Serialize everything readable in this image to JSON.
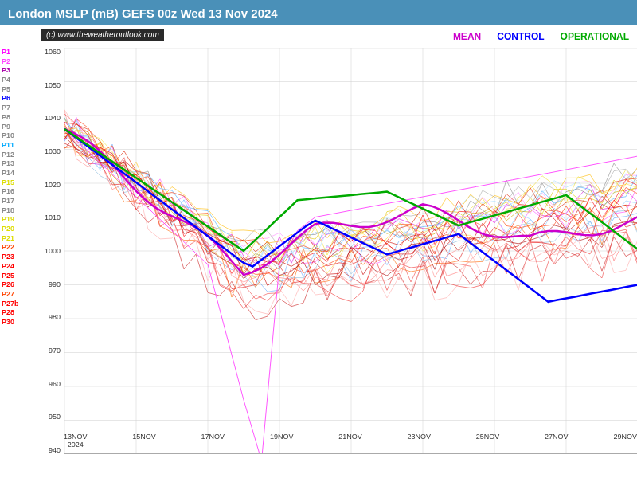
{
  "header": {
    "title": "London MSLP (mB) GEFS 00z Wed 13 Nov 2024"
  },
  "watermark": "(c) www.theweatheroutlook.com",
  "legend": {
    "mean_label": "MEAN",
    "mean_color": "#cc00cc",
    "control_label": "CONTROL",
    "control_color": "#0000ff",
    "operational_label": "OPERATIONAL",
    "operational_color": "#00aa00"
  },
  "y_axis": {
    "min": 940,
    "max": 1060,
    "step": 10,
    "labels": [
      "1060",
      "1050",
      "1040",
      "1030",
      "1020",
      "1010",
      "1000",
      "990",
      "980",
      "970",
      "960",
      "950",
      "940"
    ]
  },
  "x_axis": {
    "labels": [
      "13NOV\n2024",
      "15NOV",
      "17NOV",
      "19NOV",
      "21NOV",
      "23NOV",
      "25NOV",
      "27NOV",
      "29NOV"
    ]
  },
  "left_legend": {
    "items": [
      {
        "label": "P1",
        "color": "#ff00ff"
      },
      {
        "label": "P2",
        "color": "#ff44ff"
      },
      {
        "label": "P3",
        "color": "#aa00aa"
      },
      {
        "label": "P4",
        "color": "#888888"
      },
      {
        "label": "P5",
        "color": "#888888"
      },
      {
        "label": "P6",
        "color": "#0000ff"
      },
      {
        "label": "P7",
        "color": "#888888"
      },
      {
        "label": "P8",
        "color": "#888888"
      },
      {
        "label": "P9",
        "color": "#888888"
      },
      {
        "label": "P10",
        "color": "#888888"
      },
      {
        "label": "P11",
        "color": "#00aaff"
      },
      {
        "label": "P12",
        "color": "#888888"
      },
      {
        "label": "P13",
        "color": "#888888"
      },
      {
        "label": "P14",
        "color": "#888888"
      },
      {
        "label": "P15",
        "color": "#dddd00"
      },
      {
        "label": "P16",
        "color": "#888888"
      },
      {
        "label": "P17",
        "color": "#888888"
      },
      {
        "label": "P18",
        "color": "#888888"
      },
      {
        "label": "P19",
        "color": "#dddd00"
      },
      {
        "label": "P20",
        "color": "#dddd00"
      },
      {
        "label": "P21",
        "color": "#dddd00"
      },
      {
        "label": "P22",
        "color": "#ff4400"
      },
      {
        "label": "P23",
        "color": "#ff0000"
      },
      {
        "label": "P24",
        "color": "#ff0000"
      },
      {
        "label": "P25",
        "color": "#ff0000"
      },
      {
        "label": "P26",
        "color": "#ff0000"
      },
      {
        "label": "P27",
        "color": "#ff4400"
      },
      {
        "label": "P27b",
        "color": "#ff0000"
      },
      {
        "label": "P28",
        "color": "#ff0000"
      },
      {
        "label": "P30",
        "color": "#ff0000"
      }
    ]
  }
}
